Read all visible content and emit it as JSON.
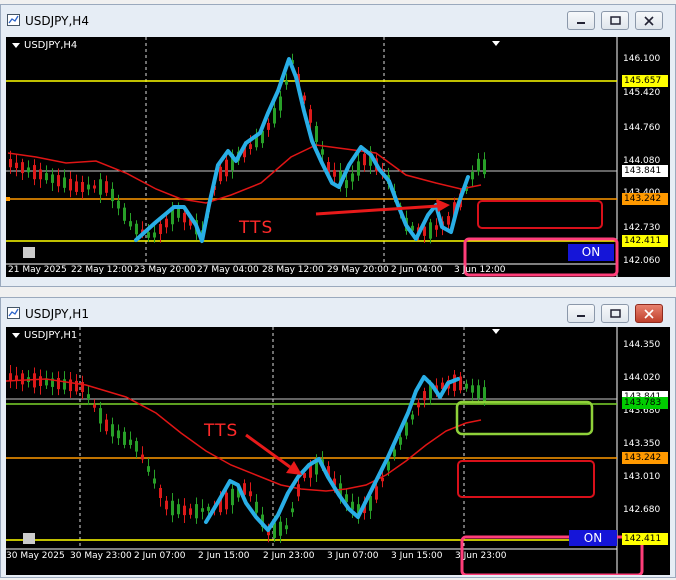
{
  "windows": [
    {
      "title": "USDJPY,H4",
      "symbol_label": "USDJPY,H4",
      "price_labels": [
        "146.100",
        "145.420",
        "144.760",
        "144.080",
        "143.400",
        "142.730",
        "142.060"
      ],
      "price_tags": [
        {
          "text": "145.657",
          "color": "#ffff00"
        },
        {
          "text": "143.841",
          "color": "#ffffff"
        },
        {
          "text": "143.242",
          "color": "#ff9900"
        },
        {
          "text": "142.411",
          "color": "#ffff00"
        }
      ],
      "time_labels": [
        "21 May 2025",
        "22 May 12:00",
        "23 May 20:00",
        "27 May 04:00",
        "28 May 12:00",
        "29 May 20:00",
        "2 Jun 04:00",
        "3 Jun 12:00"
      ],
      "annotation_text": "TTS",
      "on_button_label": "ON"
    },
    {
      "title": "USDJPY,H1",
      "symbol_label": "USDJPY,H1",
      "price_labels": [
        "144.350",
        "144.020",
        "143.680",
        "143.350",
        "143.010",
        "142.680"
      ],
      "price_tags": [
        {
          "text": "143.841",
          "color": "#ffffff"
        },
        {
          "text": "143.783",
          "color": "#00cc00"
        },
        {
          "text": "143.242",
          "color": "#ff9900"
        },
        {
          "text": "142.411",
          "color": "#ffff00"
        }
      ],
      "time_labels": [
        "30 May 2025",
        "30 May 23:00",
        "2 Jun 07:00",
        "2 Jun 15:00",
        "2 Jun 23:00",
        "3 Jun 07:00",
        "3 Jun 15:00",
        "3 Jun 23:00"
      ],
      "annotation_text": "TTS",
      "on_button_label": "ON"
    }
  ],
  "colors": {
    "bull_candle": "#28a028",
    "bear_candle": "#dd1a1a",
    "moving_average": "#e01515",
    "hand_drawn_line": "#29aee6",
    "support_yellow": "#ffff00",
    "level_orange": "#ff9900",
    "level_green": "#7cd42a",
    "box_red": "#d8101a",
    "box_pink": "#ff3e7a",
    "box_green": "#8fd13a"
  }
}
